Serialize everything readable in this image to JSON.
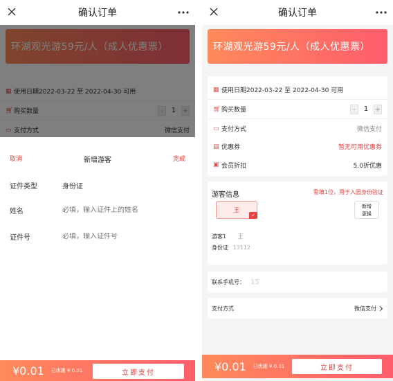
{
  "nav": {
    "title": "确认订单",
    "close_icon": "close-icon",
    "more_icon": "more-dots-icon"
  },
  "product": {
    "title": "环湖观光游59元/人（成人优惠票）"
  },
  "order": {
    "date_text": "使用日期2022-03-22 至 2022-04-30 可用",
    "quantity_label": "购买数量",
    "quantity_minus": "-",
    "quantity_value": "1",
    "quantity_plus": "+",
    "payment_label": "支付方式",
    "payment_value": "微信支付",
    "coupon_label": "优惠券",
    "coupon_value": "暂无可用优惠券",
    "member_label": "会员折扣",
    "member_value": "5.0折优惠"
  },
  "add_visitor": {
    "cancel": "取消",
    "title": "新增游客",
    "done": "完成",
    "id_type_label": "证件类型",
    "id_type_value": "身份证",
    "name_label": "姓名",
    "name_placeholder": "必填，输入证件上的姓名",
    "id_no_label": "证件号",
    "id_no_placeholder": "必填，输入证件号"
  },
  "visitors": {
    "title": "游客信息",
    "hint": "需填1位，用于入园身份验证",
    "chip_name": "王",
    "add_btn_line1": "新增",
    "add_btn_line2": "更换",
    "visitor_label": "游客1",
    "visitor_name": "王",
    "id_label": "身份证",
    "id_value": "13112"
  },
  "contact": {
    "label": "联系手机号：",
    "value": "15"
  },
  "pay_method": {
    "label": "支付方式",
    "value": "微信支付"
  },
  "paybar": {
    "price": "¥0.01",
    "saved": "已优惠 ¥ 0.01",
    "button": "立即支付"
  },
  "colors": {
    "accent_start": "#ff8a5b",
    "accent_end": "#ff5d6c",
    "red": "#e64340"
  }
}
